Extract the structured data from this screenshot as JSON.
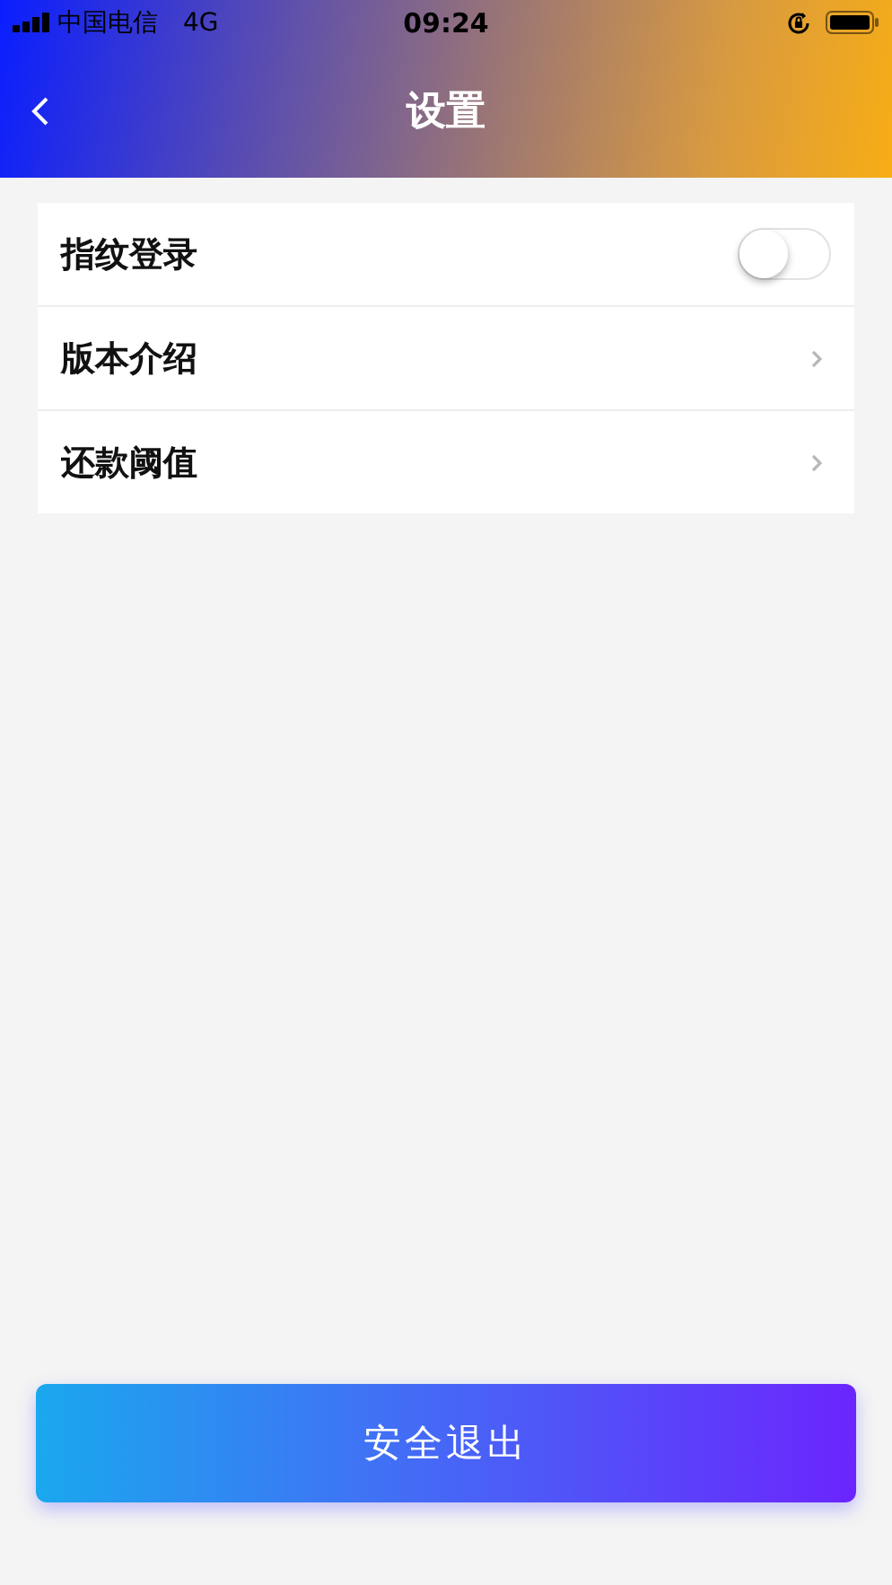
{
  "status_bar": {
    "carrier": "中国电信",
    "network": "4G",
    "time": "09:24"
  },
  "nav": {
    "title": "设置"
  },
  "items": [
    {
      "kind": "toggle",
      "label": "指纹登录",
      "on": false
    },
    {
      "kind": "link",
      "label": "版本介绍"
    },
    {
      "kind": "link",
      "label": "还款阈值"
    }
  ],
  "logout_button": "安全退出"
}
